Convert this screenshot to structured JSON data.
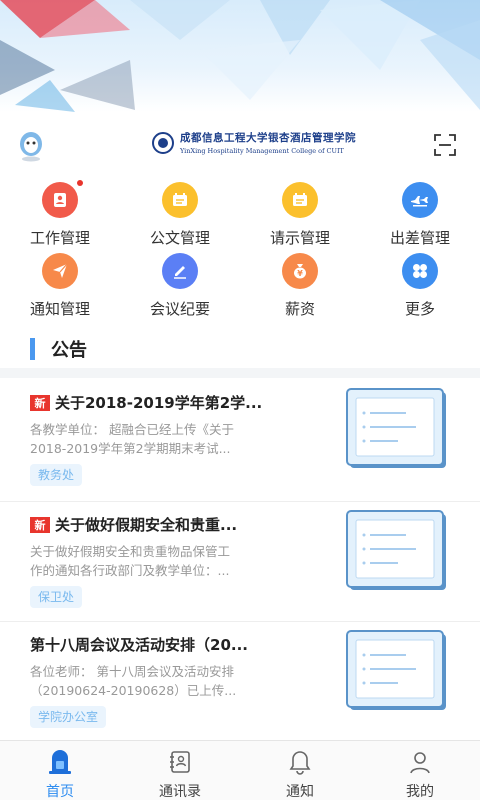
{
  "header": {
    "college_name_cn": "成都信息工程大学银杏酒店管理学院",
    "college_name_en": "YinXing Hospitality Management College of CUIT"
  },
  "grid": [
    {
      "label": "工作管理",
      "icon": "user-shield-icon",
      "color": "#f15a4a",
      "badge": true
    },
    {
      "label": "公文管理",
      "icon": "document-icon",
      "color": "#fbc02d",
      "badge": false
    },
    {
      "label": "请示管理",
      "icon": "clipboard-icon",
      "color": "#fbc02d",
      "badge": false
    },
    {
      "label": "出差管理",
      "icon": "airplane-icon",
      "color": "#3d8ef0",
      "badge": false
    },
    {
      "label": "通知管理",
      "icon": "send-icon",
      "color": "#f7894a",
      "badge": false
    },
    {
      "label": "会议纪要",
      "icon": "pen-icon",
      "color": "#5b7ff5",
      "badge": false
    },
    {
      "label": "薪资",
      "icon": "money-bag-icon",
      "color": "#f7894a",
      "badge": false
    },
    {
      "label": "更多",
      "icon": "clover-icon",
      "color": "#3d8ef0",
      "badge": false
    }
  ],
  "announcements": {
    "title": "公告",
    "items": [
      {
        "is_new": true,
        "new_label": "新",
        "title": "关于2018-2019学年第2学...",
        "body_line1": "各教学单位： 超融合已经上传《关于",
        "body_line2": "2018-2019学年第2学期期末考试...",
        "department": "教务处"
      },
      {
        "is_new": true,
        "new_label": "新",
        "title": "关于做好假期安全和贵重...",
        "body_line1": "关于做好假期安全和贵重物品保管工",
        "body_line2": "作的通知各行政部门及教学单位：...",
        "department": "保卫处"
      },
      {
        "is_new": false,
        "new_label": "",
        "title": "第十八周会议及活动安排（20...",
        "body_line1": "各位老师： 第十八周会议及活动安排",
        "body_line2": "（20190624-20190628）已上传...",
        "department": "学院办公室"
      }
    ]
  },
  "tabbar": [
    {
      "label": "首页",
      "icon": "home-icon",
      "active": true
    },
    {
      "label": "通讯录",
      "icon": "contacts-icon",
      "active": false
    },
    {
      "label": "通知",
      "icon": "bell-icon",
      "active": false
    },
    {
      "label": "我的",
      "icon": "person-icon",
      "active": false
    }
  ],
  "colors": {
    "accent": "#2d8cf0",
    "new_tag": "#e8352d",
    "muted_text": "#999999"
  }
}
